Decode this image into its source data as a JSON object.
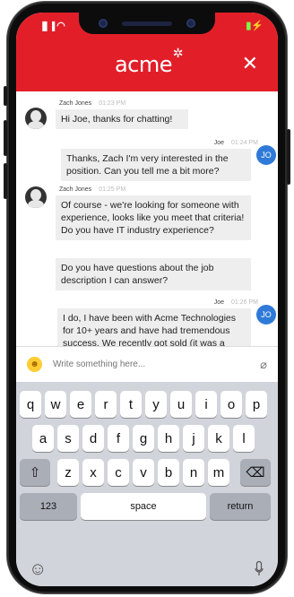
{
  "status": {
    "signal": "▐▌▐",
    "wifi": "◠",
    "battery": "▮⚡"
  },
  "header": {
    "logo": "acme",
    "close_icon": "✕"
  },
  "messages": [
    {
      "sender": "Zach Jones",
      "time": "01:23 PM",
      "text": "Hi Joe, thanks for chatting!",
      "side": "left"
    },
    {
      "sender": "Joe",
      "time": "01:24 PM",
      "text": "Thanks, Zach  I'm very interested in the position. Can you tell me a bit more?",
      "side": "right",
      "initials": "JO"
    },
    {
      "sender": "Zach Jones",
      "time": "01:25 PM",
      "text": "Of course - we're looking for someone with experience, looks like you meet that criteria! Do you have IT industry experience?",
      "side": "left"
    },
    {
      "text": "Do you have questions about the job description I can answer?",
      "side": "left"
    },
    {
      "sender": "Joe",
      "time": "01:26 PM",
      "text": "I do, I have been with Acme Technologies for 10+ years and have had tremendous success. We recently got sold (it was a great run!) and now I am ready for a new",
      "side": "right",
      "initials": "JO"
    }
  ],
  "composer": {
    "placeholder": "Write something here..."
  },
  "keyboard": {
    "row1": [
      "q",
      "w",
      "e",
      "r",
      "t",
      "y",
      "u",
      "i",
      "o",
      "p"
    ],
    "row2": [
      "a",
      "s",
      "d",
      "f",
      "g",
      "h",
      "j",
      "k",
      "l"
    ],
    "row3": [
      "z",
      "x",
      "c",
      "v",
      "b",
      "n",
      "m"
    ],
    "shift": "⇧",
    "backspace": "⌫",
    "numbers": "123",
    "space": "space",
    "return": "return",
    "emoji": "☺",
    "mic": "🎙"
  },
  "colors": {
    "brand": "#e21f29",
    "agent_avatar": "#2f7ad8"
  }
}
